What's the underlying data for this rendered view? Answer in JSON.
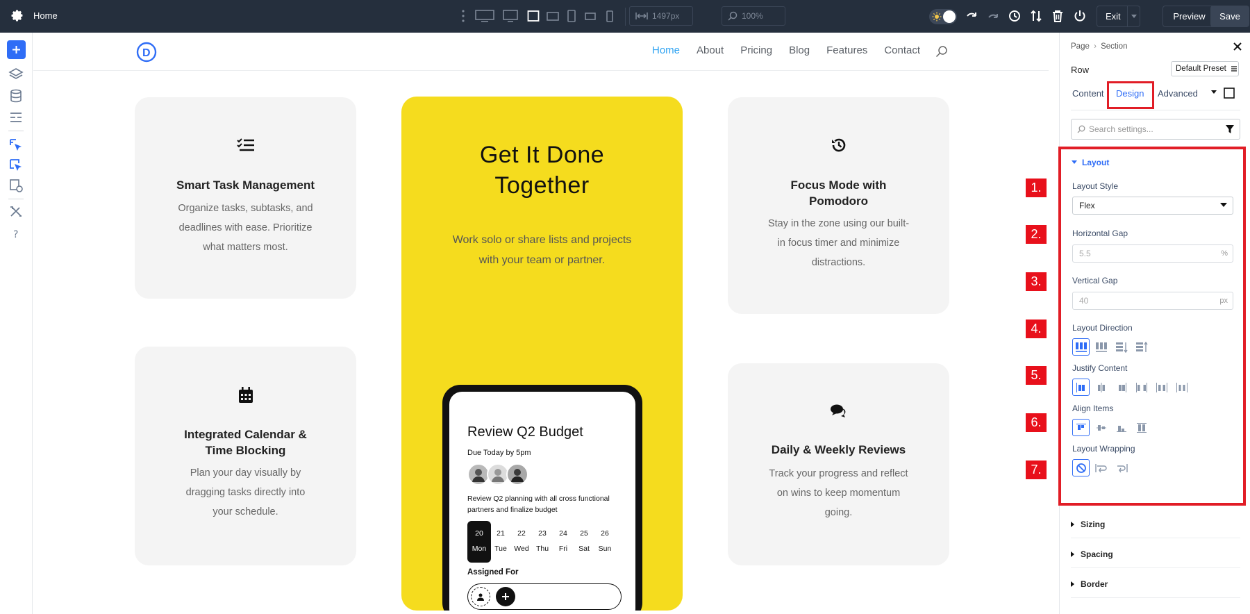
{
  "topbar": {
    "title": "Home",
    "width_value": "1497px",
    "zoom_value": "100%",
    "exit_label": "Exit",
    "preview_label": "Preview",
    "save_label": "Save",
    "colors": {
      "bg": "#252f3d"
    }
  },
  "canvas": {
    "nav": {
      "logo_letter": "D",
      "items": [
        "Home",
        "About",
        "Pricing",
        "Blog",
        "Features",
        "Contact"
      ],
      "active": "Home"
    },
    "cards": [
      {
        "title": "Smart Task Management",
        "text": [
          "Organize tasks, subtasks, and",
          "deadlines with ease. Prioritize",
          "what matters most."
        ],
        "icon": "checklist-icon"
      },
      {
        "title": "Integrated Calendar &",
        "title2": "Time Blocking",
        "text": [
          "Plan your day visually by",
          "dragging tasks directly into",
          "your schedule."
        ],
        "icon": "calendar-icon"
      },
      {
        "title": "Focus Mode with",
        "title2": "Pomodoro",
        "text": [
          "Stay in the zone using our built-",
          "in focus timer and minimize",
          "distractions."
        ],
        "icon": "history-icon"
      },
      {
        "title": "Daily & Weekly Reviews",
        "text": [
          "Track your progress and reflect",
          "on wins to keep momentum",
          "going."
        ],
        "icon": "comments-icon"
      }
    ],
    "hero": {
      "title_line1": "Get It Done",
      "title_line2": "Together",
      "text": "Work solo or share lists and projects with your team or partner.",
      "color": "#f5dc1e"
    },
    "phone": {
      "title": "Review Q2 Budget",
      "due": "Due Today by 5pm",
      "desc": "Review Q2 planning with all cross functional partners and finalize budget",
      "days": [
        {
          "n": "20",
          "d": "Mon"
        },
        {
          "n": "21",
          "d": "Tue"
        },
        {
          "n": "22",
          "d": "Wed"
        },
        {
          "n": "23",
          "d": "Thu"
        },
        {
          "n": "24",
          "d": "Fri"
        },
        {
          "n": "25",
          "d": "Sat"
        },
        {
          "n": "26",
          "d": "Sun"
        }
      ],
      "assigned_label": "Assigned For"
    }
  },
  "panel": {
    "breadcrumb_page": "Page",
    "breadcrumb_section": "Section",
    "element": "Row",
    "preset": "Default Preset",
    "tabs": [
      "Content",
      "Design",
      "Advanced"
    ],
    "active_tab": "Design",
    "search_placeholder": "Search settings...",
    "layout": {
      "title": "Layout",
      "style_label": "Layout Style",
      "style_value": "Flex",
      "hgap_label": "Horizontal Gap",
      "hgap_value": "5.5",
      "hgap_unit": "%",
      "vgap_label": "Vertical Gap",
      "vgap_value": "40",
      "vgap_unit": "px",
      "direction_label": "Layout Direction",
      "justify_label": "Justify Content",
      "align_label": "Align Items",
      "wrap_label": "Layout Wrapping"
    },
    "collapsed": [
      "Sizing",
      "Spacing",
      "Border"
    ],
    "badges": [
      "1.",
      "2.",
      "3.",
      "4.",
      "5.",
      "6.",
      "7."
    ],
    "colors": {
      "accent": "#2f6df6",
      "highlight": "#e11d26"
    }
  }
}
